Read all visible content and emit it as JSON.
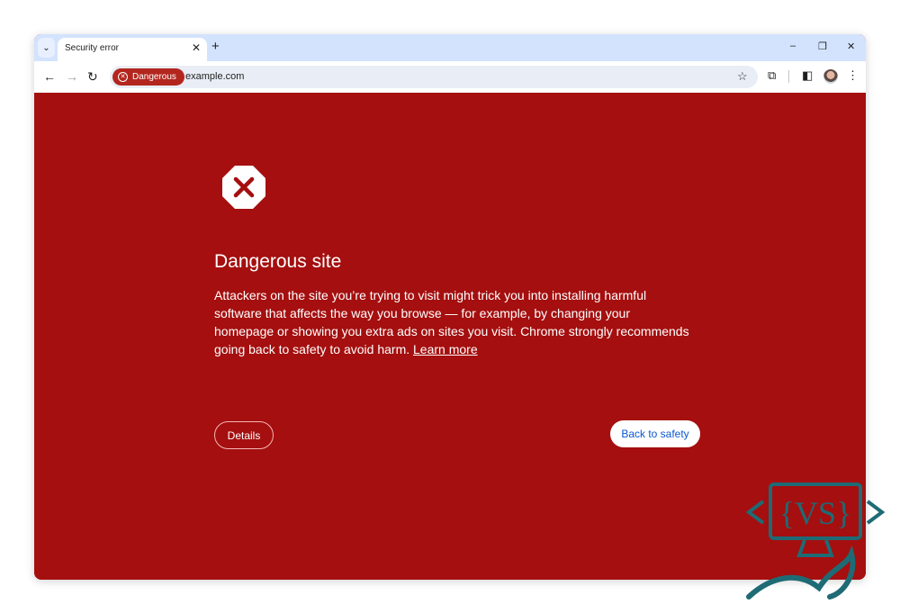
{
  "browser": {
    "tab": {
      "title": "Security error",
      "close_glyph": "✕"
    },
    "tab_search_glyph": "⌄",
    "new_tab_glyph": "+",
    "window_controls": {
      "minimize": "–",
      "restore": "❐",
      "close": "✕"
    },
    "nav": {
      "back": "←",
      "forward": "→",
      "reload": "↻"
    },
    "omnibox": {
      "security_chip_label": "Dangerous",
      "security_chip_icon": "⊗",
      "url": "example.com",
      "bookmark_glyph": "☆"
    },
    "toolbar_icons": {
      "extensions": "⧉",
      "side_panel": "◧",
      "menu": "⋮"
    }
  },
  "page": {
    "heading": "Dangerous site",
    "body_text": "Attackers on the site you’re trying to visit might trick you into installing harmful software that affects the way you browse — for example, by changing your homepage or showing you extra ads on sites you visit. Chrome strongly recommends going back to safety to avoid harm. ",
    "learn_more_label": "Learn more",
    "details_button": "Details",
    "back_button": "Back to safety"
  },
  "colors": {
    "page_background": "#a50f0f",
    "chip_background": "#b3261e",
    "primary_button_text": "#0b57d0",
    "tab_strip": "#d3e3fd",
    "watermark": "#1e6b75"
  }
}
